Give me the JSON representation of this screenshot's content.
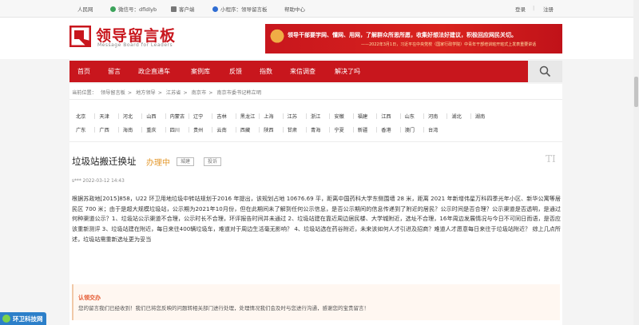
{
  "topbar": {
    "people": "人民网",
    "wechat": "微信号：dfldlyb",
    "client": "客户端",
    "miniapp": "小程序：领导留言板",
    "help": "帮助中心",
    "login": "登录",
    "sep": "|",
    "register": "注册"
  },
  "logo": {
    "title": "领导留言板",
    "subtitle": "Message Board for Leaders"
  },
  "banner": {
    "headline": "领导干部要学网、懂网、用网，了解群众所思所愿，收集好想法好建议，积极回应网民关切。",
    "source": "——2022年3月1日，习近平在中央党校（国家行政学院）中青年干部培训班开班式上发表重要讲话"
  },
  "nav": {
    "items": [
      "首页",
      "留言",
      "政企直通车",
      "案例库",
      "反馈",
      "指数",
      "来信调查",
      "解决了吗"
    ],
    "search_icon": "search-icon"
  },
  "breadcrumb": {
    "label": "当前位置：",
    "items": [
      "领导留言板",
      "地方领导",
      "江苏省",
      "南京市",
      "南京市委书记韩立明"
    ],
    "separator": ">"
  },
  "provinces": {
    "row1": [
      "北京",
      "天津",
      "河北",
      "山西",
      "内蒙古",
      "辽宁",
      "吉林",
      "黑龙江",
      "上海",
      "江苏",
      "浙江",
      "安徽",
      "福建",
      "江西",
      "山东",
      "河南",
      "湖北",
      "湖南"
    ],
    "row2": [
      "广东",
      "广西",
      "海南",
      "重庆",
      "四川",
      "贵州",
      "云南",
      "西藏",
      "陕西",
      "甘肃",
      "青海",
      "宁夏",
      "新疆",
      "香港",
      "澳门",
      "台湾"
    ]
  },
  "question": {
    "title": "垃圾站搬迁换址",
    "status": "办理中",
    "tags": [
      "城建",
      "投诉"
    ],
    "watermark": "TI",
    "author_date": "s***     2022-03-12 14:43",
    "body": "根据苏政地[2015]858，U22 环卫用地垃圾中转站规划于2016 年提出，该规划占地 10676.69 平，距离中国药科大学东侧围墙 28 米，距离 2021 年新增伟星万科四季光年小区、新华公寓等居民区 700 米；由于是超大规模垃圾站，公示期为2021年10月份，但在此期间未了解到任何公示信息，是否公示期间的信息传递到了附近的居民？公示时间是否合理？公示渠道是否透明，是通过何种渠道公示？1、垃圾站公示渠道不合理，公示时长不合理，环评报告时间并未通过 2、垃圾站建在靠近周边居民楼、大学城附近，选址不合理，16年周边发展情况与今日不可同日而语，是否应该重新测评 3、垃圾站建在附近，每日来往400辆垃圾车，难道对于周边生活毫无影响？ 4、垃圾站选在药谷附近，未来该如何人才引进及招商？难道人才愿意每日来往于垃圾站附近？ 综上几点所述，垃圾站需重新选址更为妥当"
  },
  "reply": {
    "heading": "认领交办",
    "text": "您的留言我们已经收到！我们已将您反映的问题转相关部门进行处理，处理情况我们会及时与您进行沟通，感谢您的宝贵留言！"
  },
  "float_logo": {
    "text": "环卫科技网"
  },
  "colors": {
    "brand_red": "#c8161d",
    "status_orange": "#e4982b",
    "reply_orange": "#e4572e"
  }
}
